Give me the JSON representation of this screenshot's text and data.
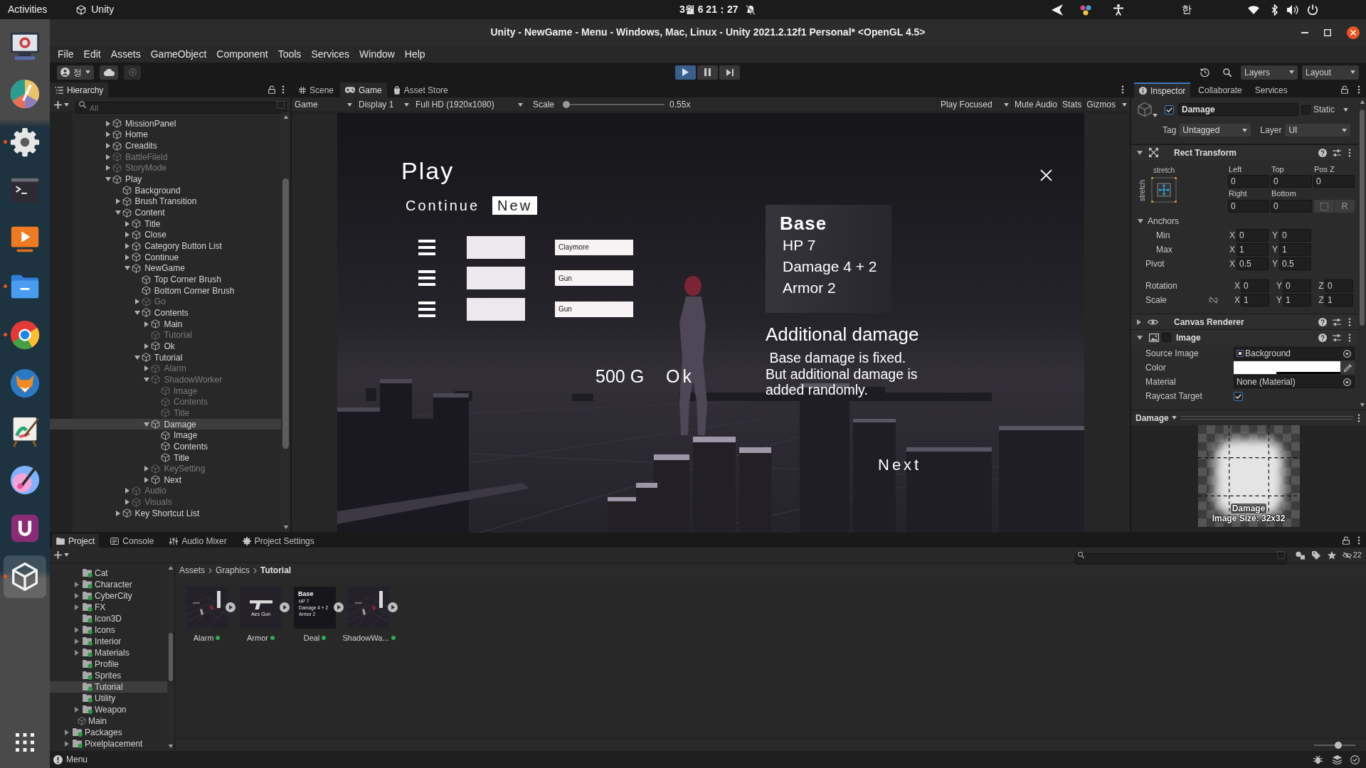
{
  "top_bar": {
    "activities": "Activities",
    "app": "Unity",
    "clock": "3월 6 21：27",
    "notifications_muted": true,
    "input_method": "한"
  },
  "dock": [
    {
      "kind": "monitor",
      "running": false,
      "selected": false
    },
    {
      "kind": "palette",
      "running": false,
      "selected": false
    },
    {
      "kind": "settings",
      "running": true,
      "selected": false
    },
    {
      "kind": "terminal",
      "running": false,
      "selected": false
    },
    {
      "kind": "video",
      "running": false,
      "selected": false
    },
    {
      "kind": "files",
      "running": true,
      "selected": false
    },
    {
      "kind": "browser",
      "running": true,
      "selected": false
    },
    {
      "kind": "fox",
      "running": false,
      "selected": false
    },
    {
      "kind": "easel",
      "running": false,
      "selected": false
    },
    {
      "kind": "paint",
      "running": false,
      "selected": false
    },
    {
      "kind": "u",
      "running": false,
      "selected": false
    },
    {
      "kind": "unity",
      "running": true,
      "selected": true
    }
  ],
  "window": {
    "title": "Unity - NewGame - Menu - Windows, Mac, Linux - Unity 2021.2.12f1 Personal* <OpenGL 4.5>",
    "menu": [
      "File",
      "Edit",
      "Assets",
      "GameObject",
      "Component",
      "Tools",
      "Services",
      "Window",
      "Help"
    ]
  },
  "toolbar": {
    "account": "정",
    "playback": [
      {
        "kind": "play",
        "on": true
      },
      {
        "kind": "pause",
        "on": false
      },
      {
        "kind": "step",
        "on": false
      }
    ],
    "layers": "Layers",
    "layout": "Layout"
  },
  "hierarchy": {
    "title": "Hierarchy",
    "search": {
      "placeholder": "All"
    },
    "items": [
      {
        "label": "MissionPanel",
        "expanded": false,
        "disabled": false,
        "selected": false
      },
      {
        "label": "Home",
        "expanded": false,
        "disabled": false,
        "selected": false
      },
      {
        "label": "Creadits",
        "expanded": false,
        "disabled": false,
        "selected": false
      },
      {
        "label": "BattleFileld",
        "expanded": false,
        "disabled": true,
        "selected": false
      },
      {
        "label": "StoryMode",
        "expanded": false,
        "disabled": true,
        "selected": false
      },
      {
        "label": "Play",
        "expanded": true,
        "disabled": false,
        "selected": false,
        "children": [
          {
            "label": "Background",
            "disabled": false,
            "selected": false
          },
          {
            "label": "Brush Transition",
            "expanded": false,
            "disabled": false,
            "selected": false
          },
          {
            "label": "Content",
            "expanded": true,
            "disabled": false,
            "selected": false,
            "children": [
              {
                "label": "Title",
                "expanded": false,
                "disabled": false,
                "selected": false
              },
              {
                "label": "Close",
                "expanded": false,
                "disabled": false,
                "selected": false
              },
              {
                "label": "Category Button List",
                "expanded": false,
                "disabled": false,
                "selected": false
              },
              {
                "label": "Continue",
                "expanded": false,
                "disabled": false,
                "selected": false
              },
              {
                "label": "NewGame",
                "expanded": true,
                "disabled": false,
                "selected": false,
                "children": [
                  {
                    "label": "Top Corner Brush",
                    "disabled": false,
                    "selected": false
                  },
                  {
                    "label": "Bottom Corner Brush",
                    "disabled": false,
                    "selected": false
                  },
                  {
                    "label": "Go",
                    "expanded": false,
                    "disabled": true,
                    "selected": false
                  },
                  {
                    "label": "Contents",
                    "expanded": true,
                    "disabled": false,
                    "selected": false,
                    "children": [
                      {
                        "label": "Main",
                        "expanded": false,
                        "disabled": false,
                        "selected": false
                      },
                      {
                        "label": "Tutorial",
                        "disabled": true,
                        "selected": false
                      },
                      {
                        "label": "Ok",
                        "expanded": false,
                        "disabled": false,
                        "selected": false
                      }
                    ]
                  },
                  {
                    "label": "Tutorial",
                    "expanded": true,
                    "disabled": false,
                    "selected": false,
                    "children": [
                      {
                        "label": "Alarm",
                        "expanded": false,
                        "disabled": true,
                        "selected": false
                      },
                      {
                        "label": "ShadowWorker",
                        "expanded": true,
                        "disabled": true,
                        "selected": false,
                        "children": [
                          {
                            "label": "Image",
                            "disabled": true,
                            "selected": false
                          },
                          {
                            "label": "Contents",
                            "disabled": true,
                            "selected": false
                          },
                          {
                            "label": "Title",
                            "disabled": true,
                            "selected": false
                          }
                        ]
                      },
                      {
                        "label": "Damage",
                        "expanded": true,
                        "disabled": false,
                        "selected": true,
                        "children": [
                          {
                            "label": "Image",
                            "disabled": false,
                            "selected": false
                          },
                          {
                            "label": "Contents",
                            "disabled": false,
                            "selected": false
                          },
                          {
                            "label": "Title",
                            "disabled": false,
                            "selected": false
                          }
                        ]
                      },
                      {
                        "label": "KeySetting",
                        "expanded": false,
                        "disabled": true,
                        "selected": false
                      },
                      {
                        "label": "Next",
                        "expanded": false,
                        "disabled": false,
                        "selected": false
                      }
                    ]
                  }
                ]
              },
              {
                "label": "Audio",
                "expanded": false,
                "disabled": true,
                "selected": false
              },
              {
                "label": "Visuals",
                "expanded": false,
                "disabled": true,
                "selected": false
              }
            ]
          },
          {
            "label": "Key Shortcut List",
            "expanded": false,
            "disabled": false,
            "selected": false
          }
        ]
      }
    ]
  },
  "game_panel": {
    "tabs": [
      {
        "label": "Scene",
        "kind": "scene",
        "selected": false
      },
      {
        "label": "Game",
        "kind": "game",
        "selected": true
      },
      {
        "label": "Asset Store",
        "kind": "store",
        "selected": false
      }
    ],
    "toolbar": {
      "view": "Game",
      "display": "Display 1",
      "resolution": "Full HD (1920x1080)",
      "scale_label": "Scale",
      "scale": {
        "level": 0,
        "reading": "0.55x"
      },
      "play_mode": "Play Focused",
      "toggles": [
        {
          "label": "Mute Audio",
          "on": false
        },
        {
          "label": "Stats",
          "on": false
        },
        {
          "label": "Gizmos",
          "on": false
        }
      ]
    },
    "game": {
      "title": "Play",
      "tabs": [
        {
          "label": "Continue",
          "selected": false
        },
        {
          "label": "New",
          "selected": true
        }
      ],
      "loadout": [
        {
          "weapon": "Claymore"
        },
        {
          "weapon": "Gun"
        },
        {
          "weapon": "Gun"
        }
      ],
      "gold": "500 G",
      "ok": "Ok",
      "stats": {
        "title": "Base",
        "lines": [
          "HP 7",
          "Damage 4 + 2",
          "Armor 2"
        ]
      },
      "heading": "Additional damage",
      "body": " Base damage is fixed.\nBut additional damage is\nadded randomly.",
      "next": "Next"
    }
  },
  "inspector": {
    "tabs": [
      {
        "label": "Inspector",
        "selected": true
      },
      {
        "label": "Collaborate",
        "selected": false
      },
      {
        "label": "Services",
        "selected": false
      }
    ],
    "object": {
      "active": true,
      "name": "Damage",
      "static": false,
      "static_label": "Static",
      "tag_label": "Tag",
      "tag": "Untagged",
      "layer_label": "Layer",
      "layer": "UI"
    },
    "components": [
      {
        "kind": "rect_transform",
        "title": "Rect Transform",
        "expanded": true,
        "preset": {
          "horizontal": "stretch",
          "vertical": "stretch"
        },
        "edges": [
          {
            "label": "Left",
            "value": "0"
          },
          {
            "label": "Top",
            "value": "0"
          },
          {
            "label": "Pos Z",
            "value": "0"
          },
          {
            "label": "Right",
            "value": "0"
          },
          {
            "label": "Bottom",
            "value": "0"
          }
        ],
        "raw_edit": "R",
        "rows": [
          {
            "kind": "foldout",
            "label": "Anchors",
            "expanded": true,
            "children": [
              {
                "kind": "vector2",
                "label": "Min",
                "values": [
                  {
                    "axis": "X",
                    "value": "0"
                  },
                  {
                    "axis": "Y",
                    "value": "0"
                  }
                ]
              },
              {
                "kind": "vector2",
                "label": "Max",
                "values": [
                  {
                    "axis": "X",
                    "value": "1"
                  },
                  {
                    "axis": "Y",
                    "value": "1"
                  }
                ]
              }
            ]
          },
          {
            "kind": "vector2",
            "label": "Pivot",
            "values": [
              {
                "axis": "X",
                "value": "0.5"
              },
              {
                "axis": "Y",
                "value": "0.5"
              }
            ]
          },
          {
            "kind": "vector3",
            "label": "Rotation",
            "values": [
              {
                "axis": "X",
                "value": "0"
              },
              {
                "axis": "Y",
                "value": "0"
              },
              {
                "axis": "Z",
                "value": "0"
              }
            ]
          },
          {
            "kind": "vector3",
            "label": "Scale",
            "linked": false,
            "values": [
              {
                "axis": "X",
                "value": "1"
              },
              {
                "axis": "Y",
                "value": "1"
              },
              {
                "axis": "Z",
                "value": "1"
              }
            ]
          }
        ]
      },
      {
        "kind": "canvas_renderer",
        "title": "Canvas Renderer",
        "expanded": false
      },
      {
        "kind": "image",
        "title": "Image",
        "expanded": true,
        "enabled": false,
        "props": [
          {
            "kind": "sprite_ref",
            "label": "Source Image",
            "value": "Background"
          },
          {
            "kind": "color",
            "label": "Color",
            "color": "#ffffff",
            "level": 0.4
          },
          {
            "kind": "object_ref",
            "label": "Material",
            "value": "None (Material)"
          },
          {
            "kind": "toggle",
            "label": "Raycast Target",
            "checked": true
          }
        ]
      }
    ],
    "preview": {
      "title": "Damage",
      "caption": "Damage",
      "size": "Image Size: 32x32"
    }
  },
  "project": {
    "tabs": [
      {
        "label": "Project",
        "kind": "project",
        "selected": true
      },
      {
        "label": "Console",
        "kind": "console",
        "selected": false
      },
      {
        "label": "Audio Mixer",
        "kind": "mixer",
        "selected": false
      },
      {
        "label": "Project Settings",
        "kind": "settings",
        "selected": false
      }
    ],
    "hidden_count": "22",
    "tree": [
      {
        "children": [
          {
            "children": [
              {
                "label": "Cat",
                "kind": "folder",
                "selected": false
              },
              {
                "label": "Character",
                "kind": "folder",
                "expanded": false,
                "selected": false
              },
              {
                "label": "CyberCity",
                "kind": "folder",
                "expanded": false,
                "selected": false
              },
              {
                "label": "FX",
                "kind": "folder",
                "expanded": false,
                "selected": false
              },
              {
                "label": "Icon3D",
                "kind": "folder",
                "selected": false
              },
              {
                "label": "Icons",
                "kind": "folder",
                "expanded": false,
                "selected": false
              },
              {
                "label": "Interior",
                "kind": "folder",
                "expanded": false,
                "selected": false
              },
              {
                "label": "Materials",
                "kind": "folder",
                "expanded": false,
                "selected": false
              },
              {
                "label": "Profile",
                "kind": "folder",
                "selected": false
              },
              {
                "label": "Sprites",
                "kind": "folder",
                "selected": false
              },
              {
                "label": "Tutorial",
                "kind": "folder",
                "selected": true
              },
              {
                "label": "Utility",
                "kind": "folder",
                "selected": false
              },
              {
                "label": "Weapon",
                "kind": "folder",
                "expanded": false,
                "selected": false
              }
            ]
          },
          {
            "label": "Main",
            "kind": "scene",
            "selected": false
          }
        ]
      },
      {
        "label": "Packages",
        "kind": "folder",
        "expanded": false,
        "selected": false
      },
      {
        "label": "Pixelplacement",
        "kind": "folder",
        "expanded": false,
        "selected": false
      }
    ],
    "breadcrumb": [
      {
        "label": "Assets",
        "current": false
      },
      {
        "label": "Graphics",
        "current": false
      },
      {
        "label": "Tutorial",
        "current": true
      }
    ],
    "assets": [
      {
        "name": "Alarm",
        "kind": "scene"
      },
      {
        "name": "Armor",
        "kind": "weapon",
        "caption": "Aes Gun"
      },
      {
        "name": "Deal",
        "kind": "card",
        "title": "Base",
        "lines": [
          "HP 7",
          "Damage 4 + 2",
          "Armor 2"
        ]
      },
      {
        "name": "ShadowWa...",
        "kind": "scene"
      }
    ],
    "thumbnail_size": {
      "level": 0.6
    }
  },
  "status_bar": {
    "message": "Menu"
  }
}
